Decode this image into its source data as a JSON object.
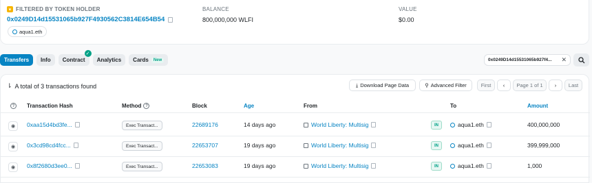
{
  "overview": {
    "filter_label": "FILTERED BY TOKEN HOLDER",
    "address": "0x0249D14d15531065b927F4930562C3814E654B54",
    "ens_chip": "aqua1.eth",
    "balance_label": "BALANCE",
    "balance_value": "800,000,000 WLFI",
    "value_label": "VALUE",
    "value_value": "$0.00"
  },
  "tabs": [
    {
      "label": "Transfers",
      "active": true
    },
    {
      "label": "Info"
    },
    {
      "label": "Contract",
      "verified": true
    },
    {
      "label": "Analytics"
    },
    {
      "label": "Cards",
      "badge": "New"
    }
  ],
  "search": {
    "value": "0x0249D14d15531065b927f4..."
  },
  "toolbar": {
    "summary": "A total of 3 transactions found",
    "download_label": "Download Page Data",
    "filter_label": "Advanced Filter",
    "first_label": "First",
    "page_label": "Page 1 of 1",
    "last_label": "Last",
    "prev_icon": "‹",
    "next_icon": "›"
  },
  "table": {
    "headers": {
      "hash": "Transaction Hash",
      "method": "Method",
      "block": "Block",
      "age": "Age",
      "from": "From",
      "to": "To",
      "amount": "Amount"
    },
    "rows": [
      {
        "hash": "0xaa15d4bd3fe...",
        "method": "Exec Transact...",
        "block": "22689176",
        "age": "14 days ago",
        "from": "World Liberty: Multisig",
        "direction": "IN",
        "to": "aqua1.eth",
        "amount": "400,000,000"
      },
      {
        "hash": "0x3cd98cd4fcc...",
        "method": "Exec Transact...",
        "block": "22653707",
        "age": "19 days ago",
        "from": "World Liberty: Multisig",
        "direction": "IN",
        "to": "aqua1.eth",
        "amount": "399,999,000"
      },
      {
        "hash": "0x8f2680d3ee0...",
        "method": "Exec Transact...",
        "block": "22653083",
        "age": "19 days ago",
        "from": "World Liberty: Multisig",
        "direction": "IN",
        "to": "aqua1.eth",
        "amount": "1,000"
      }
    ]
  },
  "colors": {
    "accent": "#0784c3",
    "success": "#00a186",
    "filter_icon": "#f7b500"
  }
}
